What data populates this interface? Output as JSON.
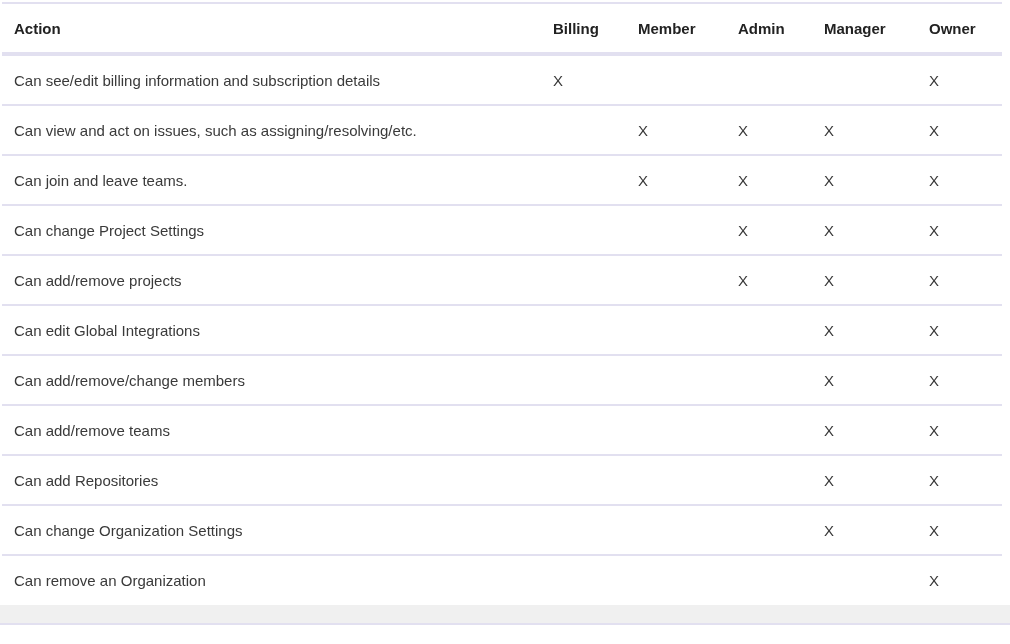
{
  "table": {
    "columns": [
      "Action",
      "Billing",
      "Member",
      "Admin",
      "Manager",
      "Owner"
    ],
    "rows": [
      {
        "action": "Can see/edit billing information and subscription details",
        "billing": "X",
        "owner": "X"
      },
      {
        "action": "Can view and act on issues, such as assigning/resolving/etc.",
        "member": "X",
        "admin": "X",
        "manager": "X",
        "owner": "X"
      },
      {
        "action": "Can join and leave teams.",
        "member": "X",
        "admin": "X",
        "manager": "X",
        "owner": "X"
      },
      {
        "action": "Can change Project Settings",
        "admin": "X",
        "manager": "X",
        "owner": "X"
      },
      {
        "action": "Can add/remove projects",
        "admin": "X",
        "manager": "X",
        "owner": "X"
      },
      {
        "action": "Can edit Global Integrations",
        "manager": "X",
        "owner": "X"
      },
      {
        "action": "Can add/remove/change members",
        "manager": "X",
        "owner": "X"
      },
      {
        "action": "Can add/remove teams",
        "manager": "X",
        "owner": "X"
      },
      {
        "action": "Can add Repositories",
        "manager": "X",
        "owner": "X"
      },
      {
        "action": "Can change Organization Settings",
        "manager": "X",
        "owner": "X"
      },
      {
        "action": "Can remove an Organization",
        "owner": "X"
      }
    ]
  }
}
